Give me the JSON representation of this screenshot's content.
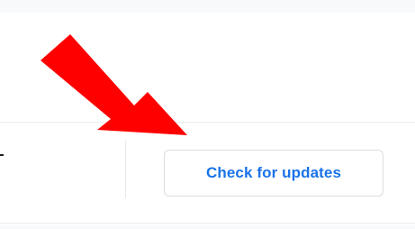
{
  "settings_row": {
    "check_updates_label": "Check for updates"
  },
  "annotation": {
    "arrow_color": "#ff0000"
  },
  "colors": {
    "accent": "#1a73e8",
    "divider": "#e8eaed",
    "button_border": "#dadce0"
  }
}
